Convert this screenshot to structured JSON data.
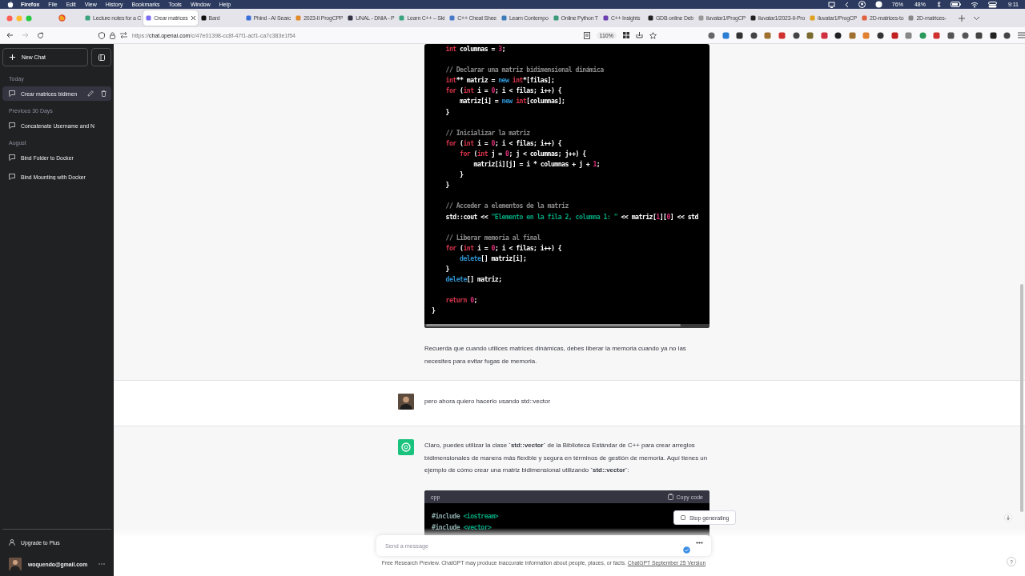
{
  "menu_bar": {
    "app": "Firefox",
    "items": [
      "File",
      "Edit",
      "View",
      "History",
      "Bookmarks",
      "Tools",
      "Window",
      "Help"
    ],
    "battery": "76%",
    "cpu": "48%",
    "clock": "9:11"
  },
  "tabs": [
    {
      "kind": "pinned",
      "selected": false
    },
    {
      "kind": "page",
      "label": "Lecture notes for a C",
      "selected": false
    },
    {
      "kind": "page",
      "label": "Crear matrices",
      "selected": true
    },
    {
      "kind": "page",
      "label": "Bard",
      "selected": false
    },
    {
      "kind": "page",
      "label": "Phind - AI Searc",
      "selected": false
    },
    {
      "kind": "page",
      "label": "2023-II ProgCPP",
      "selected": false
    },
    {
      "kind": "page",
      "label": "UNAL - DNIA - P",
      "selected": false
    },
    {
      "kind": "page",
      "label": "Learn C++ – Ski",
      "selected": false
    },
    {
      "kind": "page",
      "label": "C++ Cheat Shee",
      "selected": false
    },
    {
      "kind": "page",
      "label": "Learn Contempo",
      "selected": false
    },
    {
      "kind": "page",
      "label": "Online Python T",
      "selected": false
    },
    {
      "kind": "page",
      "label": "C++ Insights",
      "selected": false
    },
    {
      "kind": "page",
      "label": "GDB online Deb",
      "selected": false
    },
    {
      "kind": "page",
      "label": "iluvatar1/ProgCP",
      "selected": false
    },
    {
      "kind": "page",
      "label": "iluvatar1/2023-II-Pro",
      "selected": false
    },
    {
      "kind": "page",
      "label": "iluvatar1/ProgCP",
      "selected": false
    },
    {
      "kind": "page",
      "label": "2D-matrices-to",
      "selected": false
    },
    {
      "kind": "page",
      "label": "2D-matrices-",
      "selected": false
    }
  ],
  "address_bar": {
    "scheme": "https://",
    "host": "chat.openai.com",
    "path": "/c/47e01398-cc8f-47f1-acf1-ca7c383e1f54",
    "zoom": "110%"
  },
  "sidebar": {
    "new_chat": "New Chat",
    "groups": [
      {
        "label": "Today",
        "items": [
          {
            "title": "Crear matrices bidimen",
            "selected": true
          }
        ]
      },
      {
        "label": "Previous 30 Days",
        "items": [
          {
            "title": "Concatenate Username and N",
            "selected": false
          }
        ]
      },
      {
        "label": "August",
        "items": [
          {
            "title": "Bind Folder to Docker",
            "selected": false
          },
          {
            "title": "Bind Mounting with Docker",
            "selected": false
          }
        ]
      }
    ],
    "upgrade": "Upgrade to Plus",
    "user": "woquendo@gmail.com"
  },
  "messages": [
    {
      "kind": "assistant",
      "blocks": [
        {
          "kind": "code",
          "lines": [
            {
              "gap_before": false,
              "tokens": [
                {
                  "t": "    int",
                  "color": "#d8344a"
                },
                {
                  "t": " columnas = "
                },
                {
                  "t": "3",
                  "color": "#df3079"
                },
                {
                  "t": ";"
                }
              ]
            },
            {
              "gap_before": true,
              "tokens": [
                {
                  "t": "    // Declarar una matriz bidimensional dinámica",
                  "color": "#8b8b8b"
                }
              ]
            },
            {
              "gap_before": false,
              "tokens": [
                {
                  "t": "    int",
                  "color": "#d8344a"
                },
                {
                  "t": "** matriz = "
                },
                {
                  "t": "new ",
                  "color": "#2e95d3"
                },
                {
                  "t": "int",
                  "color": "#d8344a"
                },
                {
                  "t": "*[filas];"
                }
              ]
            },
            {
              "gap_before": false,
              "tokens": [
                {
                  "t": "    for",
                  "color": "#d8344a"
                },
                {
                  "t": " ("
                },
                {
                  "t": "int",
                  "color": "#d8344a"
                },
                {
                  "t": " i = "
                },
                {
                  "t": "0",
                  "color": "#df3079"
                },
                {
                  "t": "; i < filas; i++) {"
                }
              ]
            },
            {
              "gap_before": false,
              "tokens": [
                {
                  "t": "        matriz[i] = "
                },
                {
                  "t": "new ",
                  "color": "#2e95d3"
                },
                {
                  "t": "int",
                  "color": "#d8344a"
                },
                {
                  "t": "[columnas];"
                }
              ]
            },
            {
              "gap_before": false,
              "tokens": [
                {
                  "t": "    }"
                }
              ]
            },
            {
              "gap_before": true,
              "tokens": [
                {
                  "t": "    // Inicializar la matriz",
                  "color": "#8b8b8b"
                }
              ]
            },
            {
              "gap_before": false,
              "tokens": [
                {
                  "t": "    for",
                  "color": "#d8344a"
                },
                {
                  "t": " ("
                },
                {
                  "t": "int",
                  "color": "#d8344a"
                },
                {
                  "t": " i = "
                },
                {
                  "t": "0",
                  "color": "#df3079"
                },
                {
                  "t": "; i < filas; i++) {"
                }
              ]
            },
            {
              "gap_before": false,
              "tokens": [
                {
                  "t": "        for",
                  "color": "#d8344a"
                },
                {
                  "t": " ("
                },
                {
                  "t": "int",
                  "color": "#d8344a"
                },
                {
                  "t": " j = "
                },
                {
                  "t": "0",
                  "color": "#df3079"
                },
                {
                  "t": "; j < columnas; j++) {"
                }
              ]
            },
            {
              "gap_before": false,
              "tokens": [
                {
                  "t": "            matriz[i][j] = i * columnas + j + "
                },
                {
                  "t": "1",
                  "color": "#df3079"
                },
                {
                  "t": ";"
                }
              ]
            },
            {
              "gap_before": false,
              "tokens": [
                {
                  "t": "        }"
                }
              ]
            },
            {
              "gap_before": false,
              "tokens": [
                {
                  "t": "    }"
                }
              ]
            },
            {
              "gap_before": true,
              "tokens": [
                {
                  "t": "    // Acceder a elementos de la matriz",
                  "color": "#8b8b8b"
                }
              ]
            },
            {
              "gap_before": false,
              "tokens": [
                {
                  "t": "    std::cout << "
                },
                {
                  "t": "\"Elemento en la fila 2, columna 1: \"",
                  "color": "#00a67d"
                },
                {
                  "t": " << matriz["
                },
                {
                  "t": "1",
                  "color": "#df3079"
                },
                {
                  "t": "]["
                },
                {
                  "t": "0",
                  "color": "#df3079"
                },
                {
                  "t": "] << std"
                }
              ]
            },
            {
              "gap_before": true,
              "tokens": [
                {
                  "t": "    // Liberar memoria al final",
                  "color": "#8b8b8b"
                }
              ]
            },
            {
              "gap_before": false,
              "tokens": [
                {
                  "t": "    for",
                  "color": "#d8344a"
                },
                {
                  "t": " ("
                },
                {
                  "t": "int",
                  "color": "#d8344a"
                },
                {
                  "t": " i = "
                },
                {
                  "t": "0",
                  "color": "#df3079"
                },
                {
                  "t": "; i < filas; i++) {"
                }
              ]
            },
            {
              "gap_before": false,
              "tokens": [
                {
                  "t": "        delete",
                  "color": "#2e95d3"
                },
                {
                  "t": "[] matriz[i];"
                }
              ]
            },
            {
              "gap_before": false,
              "tokens": [
                {
                  "t": "    }"
                }
              ]
            },
            {
              "gap_before": false,
              "tokens": [
                {
                  "t": "    delete",
                  "color": "#2e95d3"
                },
                {
                  "t": "[] matriz;"
                }
              ]
            },
            {
              "gap_before": true,
              "tokens": [
                {
                  "t": "    return ",
                  "color": "#d8344a"
                },
                {
                  "t": "0",
                  "color": "#df3079"
                },
                {
                  "t": ";"
                }
              ]
            },
            {
              "gap_before": false,
              "tokens": [
                {
                  "t": "}"
                }
              ]
            }
          ]
        },
        {
          "kind": "paragraph",
          "text": "Recuerda que cuando utilices matrices dinámicas, debes liberar la memoria cuando ya no las necesites para evitar fugas de memoria."
        }
      ]
    },
    {
      "kind": "user",
      "blocks": [
        {
          "kind": "paragraph",
          "text": "pero ahora quiero hacerlo usando std::vector"
        }
      ]
    },
    {
      "kind": "assistant",
      "blocks": [
        {
          "kind": "paragraph",
          "text": "Claro, puedes utilizar la clase **`std::vector`** de la Biblioteca Estándar de C++ para crear arreglos bidimensionales de manera más flexible y segura en términos de gestión de memoria. Aquí tienes un ejemplo de cómo crear una matriz bidimensional utilizando **`std::vector`**:"
        },
        {
          "kind": "code",
          "language": "cpp",
          "copy": "Copy code",
          "lines": [
            {
              "gap_before": false,
              "tokens": [
                {
                  "t": "#include ",
                  "color": "#8aa7a6"
                },
                {
                  "t": "<iostream>",
                  "color": "#00a67d"
                }
              ]
            },
            {
              "gap_before": false,
              "tokens": [
                {
                  "t": "#include ",
                  "color": "#8aa7a6"
                },
                {
                  "t": "<vector>",
                  "color": "#00a67d"
                }
              ]
            }
          ]
        }
      ]
    }
  ],
  "composer": {
    "placeholder": "Send a message",
    "stop_button": "Stop generating"
  },
  "footer": {
    "text": "Free Research Preview. ChatGPT may produce inaccurate information about people, places, or facts. ",
    "link": "ChatGPT September 25 Version"
  },
  "help": "?"
}
